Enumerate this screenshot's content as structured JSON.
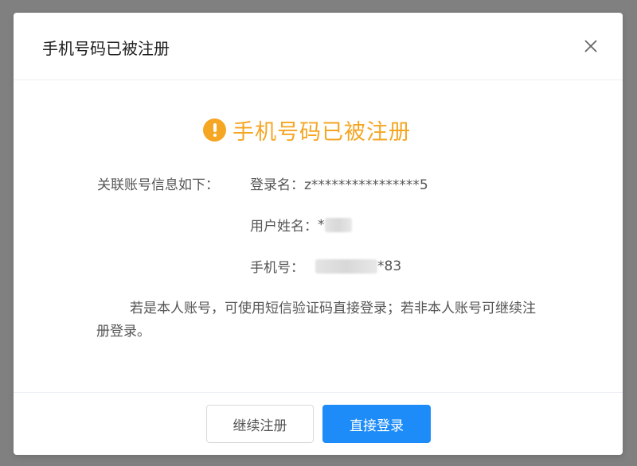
{
  "modal": {
    "title": "手机号码已被注册",
    "close_icon": "close-icon"
  },
  "notice": {
    "icon": "warning-circle-icon",
    "icon_color": "#f5a623",
    "text": "手机号码已被注册"
  },
  "account_info": {
    "label": "关联账号信息如下：",
    "login_name": "登录名：z****************5",
    "user_name_label": "用户姓名：",
    "user_name_visible": "*",
    "phone_label": "手机号：",
    "phone_visible": "*83"
  },
  "description": "若是本人账号，可使用短信验证码直接登录；若非本人账号可继续注册登录。",
  "footer": {
    "continue_label": "继续注册",
    "login_label": "直接登录",
    "primary_color": "#1d8cf8"
  }
}
